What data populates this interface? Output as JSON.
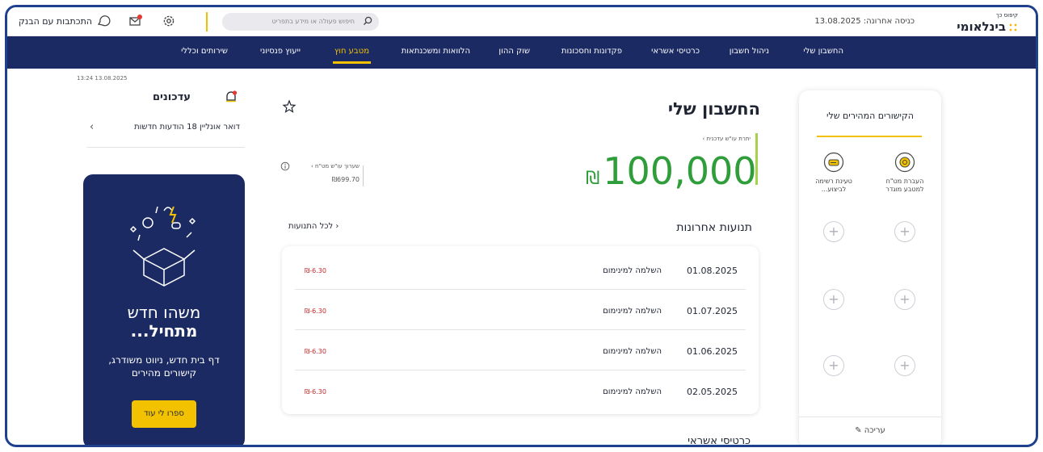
{
  "header": {
    "logo_small": "קיפוס כך",
    "logo_name": "בינלאומי",
    "last_login": "כניסה אחרונה: 13.08.2025",
    "search_placeholder": "חיפוש פעולה או מידע בתפריט",
    "contact_link": "התכתבות עם הבנק",
    "icons": [
      "message-chat-icon",
      "mail-icon",
      "settings-icon",
      "search-icon"
    ],
    "notification_color": "#e53935"
  },
  "nav": {
    "items": [
      {
        "label": "החשבון שלי",
        "active": false
      },
      {
        "label": "ניהול חשבון",
        "active": false
      },
      {
        "label": "כרטיסי אשראי",
        "active": false
      },
      {
        "label": "פקדונות וחסכונות",
        "active": false
      },
      {
        "label": "שוק ההון",
        "active": false
      },
      {
        "label": "הלוואות ומשכנתאות",
        "active": false
      },
      {
        "label": "מטבע חוץ",
        "active": true
      },
      {
        "label": "ייעוץ פנסיוני",
        "active": false
      },
      {
        "label": "שירותים וכללי",
        "active": false
      }
    ],
    "bg_color": "#1b2a63",
    "active_color": "#f2c200"
  },
  "updates": {
    "datetime": "13:24  13.08.2025",
    "title": "עדכונים",
    "mail_row": "דואר אונליין 18 הודעות חדשות"
  },
  "promo": {
    "title_line1": "משהו חדש",
    "title_line2": "מתחיל...",
    "description": "דף בית חדש, ניווט משודרג, קישורים מהירים",
    "button_label": "ספרו לי עוד"
  },
  "account": {
    "title": "החשבון שלי",
    "balance_sub": "יתרת עו\"ש עדכנית ›",
    "balance": "100,000",
    "currency": "₪",
    "mini_label": "שערוך עו\"ש מט\"ח ›",
    "mini_value": "₪699.70"
  },
  "transactions": {
    "title": "תנועות אחרונות",
    "all_link": "‹ לכל התנועות",
    "rows": [
      {
        "date": "01.08.2025",
        "desc": "השלמה למינימום",
        "amount": "₪-6.30"
      },
      {
        "date": "01.07.2025",
        "desc": "השלמה למינימום",
        "amount": "₪-6.30"
      },
      {
        "date": "01.06.2025",
        "desc": "השלמה למינימום",
        "amount": "₪-6.30"
      },
      {
        "date": "02.05.2025",
        "desc": "השלמה למינימום",
        "amount": "₪-6.30"
      }
    ]
  },
  "credit_cards": {
    "title": "כרטיסי אשראי"
  },
  "quick_links": {
    "title": "הקישורים המהירים שלי",
    "links": [
      {
        "label": "העברת מט\"ח למטבע מוגדר",
        "icon": "coin-transfer-icon"
      },
      {
        "label": "טעינת רשימה לביצוע...",
        "icon": "list-upload-icon"
      }
    ],
    "empty_slot": "+",
    "edit_label": "עריכה"
  }
}
